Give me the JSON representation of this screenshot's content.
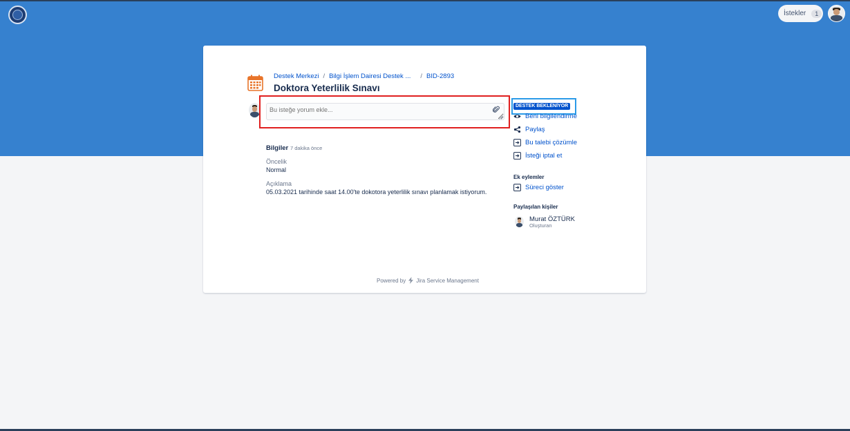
{
  "header": {
    "requests_label": "İstekler",
    "requests_count": "1"
  },
  "breadcrumb": {
    "items": [
      "Destek Merkezi",
      "Bilgi İşlem Dairesi Destek ...",
      "BID-2893"
    ],
    "separator": "/"
  },
  "request": {
    "title": "Doktora Yeterlilik Sınavı",
    "comment_placeholder": "Bu isteğe yorum ekle..."
  },
  "sidebar": {
    "status": "DESTEK BEKLENİYOR",
    "actions": [
      {
        "label": "Beni bilgilendirme",
        "icon": "eye-icon"
      },
      {
        "label": "Paylaş",
        "icon": "share-icon"
      },
      {
        "label": "Bu talebi çözümle",
        "icon": "transition-icon"
      },
      {
        "label": "İsteği iptal et",
        "icon": "transition-icon"
      }
    ],
    "extra_title": "Ek eylemler",
    "extra_actions": [
      {
        "label": "Süreci göster",
        "icon": "transition-icon"
      }
    ],
    "shared_title": "Paylaşılan kişiler",
    "people": [
      {
        "name": "Murat ÖZTÜRK",
        "role": "Oluşturan"
      }
    ]
  },
  "details": {
    "title": "Bilgiler",
    "time": "7 dakika önce",
    "fields": [
      {
        "label": "Öncelik",
        "value": "Normal"
      },
      {
        "label": "Açıklama",
        "value": "05.03.2021 tarihinde saat 14.00'te dokotora yeterlilik sınavı planlamak istiyorum."
      }
    ]
  },
  "footer": {
    "powered_by": "Powered by",
    "product": "Jira Service Management"
  },
  "colors": {
    "header_bg": "#3681cf",
    "link": "#0052cc",
    "highlight_red": "#e01e1e",
    "highlight_blue": "#2a9ae8"
  }
}
